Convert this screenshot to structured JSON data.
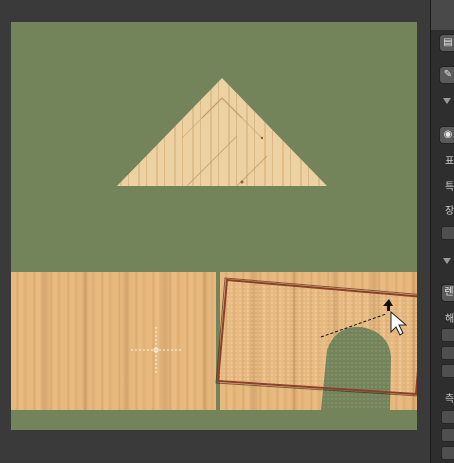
{
  "sidebar": {
    "labels": [
      "표",
      "특",
      "장",
      "렌",
      "해",
      "측"
    ]
  },
  "colors": {
    "canvas": "#74845a",
    "viewport_frame": "#3a3a3a",
    "selection_outline": "#8b3f2c",
    "wood": "#e7b97f",
    "panel": "#2e2e2e"
  },
  "icons": {
    "toolbar_top": "toolbar-grip-icon",
    "button_1": "layers-icon",
    "button_2": "pin-icon",
    "button_3": "camera-icon",
    "cursor": "arrow-cursor-icon",
    "rotate": "rotate-handle-icon",
    "crosshair": "crosshair-icon"
  }
}
